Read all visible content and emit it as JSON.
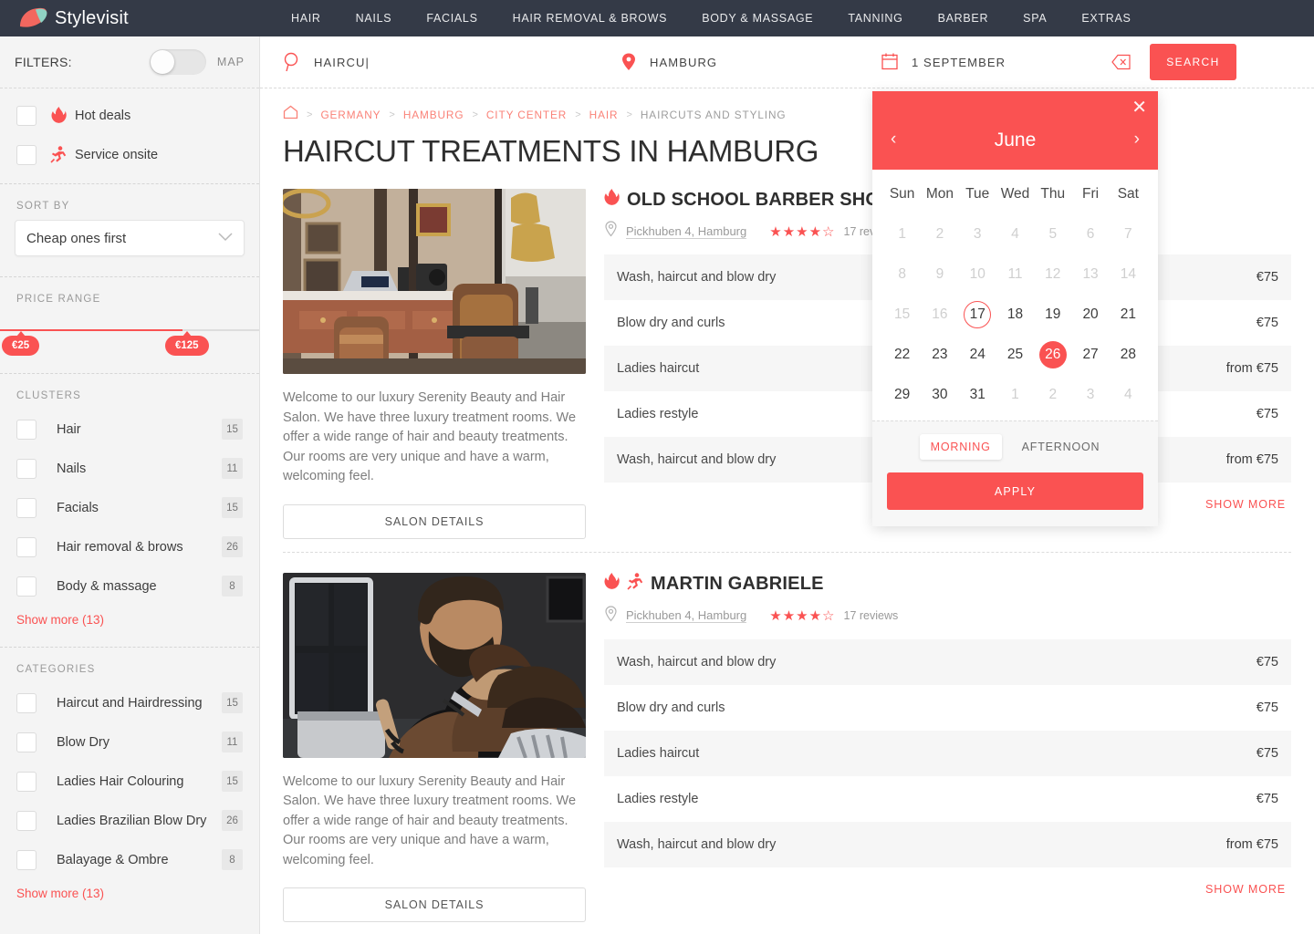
{
  "brand": {
    "name": "Stylevisit",
    "accent": "#fa5252",
    "navbg": "#343a47"
  },
  "nav": {
    "items": [
      {
        "label": "HAIR"
      },
      {
        "label": "NAILS"
      },
      {
        "label": "FACIALS"
      },
      {
        "label": "HAIR REMOVAL & BROWS"
      },
      {
        "label": "BODY & MASSAGE"
      },
      {
        "label": "TANNING"
      },
      {
        "label": "BARBER"
      },
      {
        "label": "SPA"
      },
      {
        "label": "EXTRAS"
      }
    ]
  },
  "search": {
    "query": "HAIRCU",
    "location": "HAMBURG",
    "date": "1 SEPTEMBER",
    "button": "SEARCH",
    "query_icon": "search-icon",
    "location_icon": "map-pin-icon",
    "date_icon": "calendar-icon",
    "clear_icon": "backspace-icon"
  },
  "sidebar": {
    "filters_label": "FILTERS:",
    "map_label": "MAP",
    "map_toggle_on": false,
    "quick_filters": [
      {
        "label": "Hot deals",
        "icon": "flame-icon",
        "checked": false
      },
      {
        "label": "Service onsite",
        "icon": "runner-icon",
        "checked": false
      }
    ],
    "sort": {
      "title": "SORT BY",
      "value": "Cheap ones first"
    },
    "price": {
      "title": "PRICE RANGE",
      "min_label": "€25",
      "max_label": "€125",
      "min": 25,
      "max": 125
    },
    "clusters": {
      "title": "CLUSTERS",
      "items": [
        {
          "label": "Hair",
          "count": "15"
        },
        {
          "label": "Nails",
          "count": "11"
        },
        {
          "label": "Facials",
          "count": "15"
        },
        {
          "label": "Hair removal & brows",
          "count": "26"
        },
        {
          "label": "Body & massage",
          "count": "8"
        }
      ],
      "show_more": "Show more (13)"
    },
    "categories": {
      "title": "CATEGORIES",
      "items": [
        {
          "label": "Haircut and Hairdressing",
          "count": "15"
        },
        {
          "label": "Blow Dry",
          "count": "11"
        },
        {
          "label": "Ladies Hair Colouring",
          "count": "15"
        },
        {
          "label": "Ladies Brazilian Blow Dry",
          "count": "26"
        },
        {
          "label": "Balayage & Ombre",
          "count": "8"
        }
      ],
      "show_more": "Show more (13)"
    }
  },
  "breadcrumb": {
    "home_icon": "home-icon",
    "items": [
      {
        "label": "GERMANY",
        "current": false
      },
      {
        "label": "HAMBURG",
        "current": false
      },
      {
        "label": "CITY CENTER",
        "current": false
      },
      {
        "label": "HAIR",
        "current": false
      },
      {
        "label": "HAIRCUTS AND STYLING",
        "current": true
      }
    ],
    "separator": ">"
  },
  "page_title": "HAIRCUT TREATMENTS IN HAMBURG",
  "listings": [
    {
      "name": "OLD SCHOOL BARBER SHOP",
      "badges": [
        "flame-icon"
      ],
      "address": "Pickhuben 4, Hamburg",
      "rating": 4,
      "rating_max": 5,
      "reviews": "17 reviews",
      "description": "Welcome to our luxury Serenity Beauty and Hair Salon. We have three luxury treatment rooms. We offer a wide range of hair and beauty treatments. Our rooms are very unique and have a warm, welcoming feel.",
      "details_button": "SALON DETAILS",
      "show_more": "SHOW MORE",
      "services": [
        {
          "name": "Wash, haircut and blow dry",
          "price": "€75"
        },
        {
          "name": "Blow dry and curls",
          "price": "€75"
        },
        {
          "name": "Ladies haircut",
          "price": "from €75"
        },
        {
          "name": "Ladies restyle",
          "price": "€75"
        },
        {
          "name": "Wash, haircut and blow dry",
          "price": "from €75"
        }
      ]
    },
    {
      "name": "MARTIN GABRIELE",
      "badges": [
        "flame-icon",
        "runner-icon"
      ],
      "address": "Pickhuben 4, Hamburg",
      "rating": 4,
      "rating_max": 5,
      "reviews": "17 reviews",
      "description": "Welcome to our luxury Serenity Beauty and Hair Salon. We have three luxury treatment rooms. We offer a wide range of hair and beauty treatments. Our rooms are very unique and have a warm, welcoming feel.",
      "details_button": "SALON DETAILS",
      "show_more": "SHOW MORE",
      "services": [
        {
          "name": "Wash, haircut and blow dry",
          "price": "€75"
        },
        {
          "name": "Blow dry and curls",
          "price": "€75"
        },
        {
          "name": "Ladies haircut",
          "price": "€75"
        },
        {
          "name": "Ladies restyle",
          "price": "€75"
        },
        {
          "name": "Wash, haircut and blow dry",
          "price": "from €75"
        }
      ]
    }
  ],
  "calendar": {
    "month": "June",
    "close_icon": "close-icon",
    "prev_icon": "chevron-left-icon",
    "next_icon": "chevron-right-icon",
    "dow": [
      "Sun",
      "Mon",
      "Tue",
      "Wed",
      "Thu",
      "Fri",
      "Sat"
    ],
    "days": [
      {
        "d": "1",
        "muted": true
      },
      {
        "d": "2",
        "muted": true
      },
      {
        "d": "3",
        "muted": true
      },
      {
        "d": "4",
        "muted": true
      },
      {
        "d": "5",
        "muted": true
      },
      {
        "d": "6",
        "muted": true
      },
      {
        "d": "7",
        "muted": true
      },
      {
        "d": "8",
        "muted": true
      },
      {
        "d": "9",
        "muted": true
      },
      {
        "d": "10",
        "muted": true
      },
      {
        "d": "11",
        "muted": true
      },
      {
        "d": "12",
        "muted": true
      },
      {
        "d": "13",
        "muted": true
      },
      {
        "d": "14",
        "muted": true
      },
      {
        "d": "15",
        "muted": true
      },
      {
        "d": "16",
        "muted": true
      },
      {
        "d": "17",
        "muted": false,
        "today": true
      },
      {
        "d": "18",
        "muted": false
      },
      {
        "d": "19",
        "muted": false
      },
      {
        "d": "20",
        "muted": false
      },
      {
        "d": "21",
        "muted": false
      },
      {
        "d": "22",
        "muted": false
      },
      {
        "d": "23",
        "muted": false
      },
      {
        "d": "24",
        "muted": false
      },
      {
        "d": "25",
        "muted": false
      },
      {
        "d": "26",
        "muted": false,
        "selected": true
      },
      {
        "d": "27",
        "muted": false
      },
      {
        "d": "28",
        "muted": false
      },
      {
        "d": "29",
        "muted": false
      },
      {
        "d": "30",
        "muted": false
      },
      {
        "d": "31",
        "muted": false
      },
      {
        "d": "1",
        "muted": true
      },
      {
        "d": "2",
        "muted": true
      },
      {
        "d": "3",
        "muted": true
      },
      {
        "d": "4",
        "muted": true
      }
    ],
    "segments": [
      {
        "label": "MORNING",
        "active": true
      },
      {
        "label": "AFTERNOON",
        "active": false
      }
    ],
    "apply": "APPLY"
  }
}
